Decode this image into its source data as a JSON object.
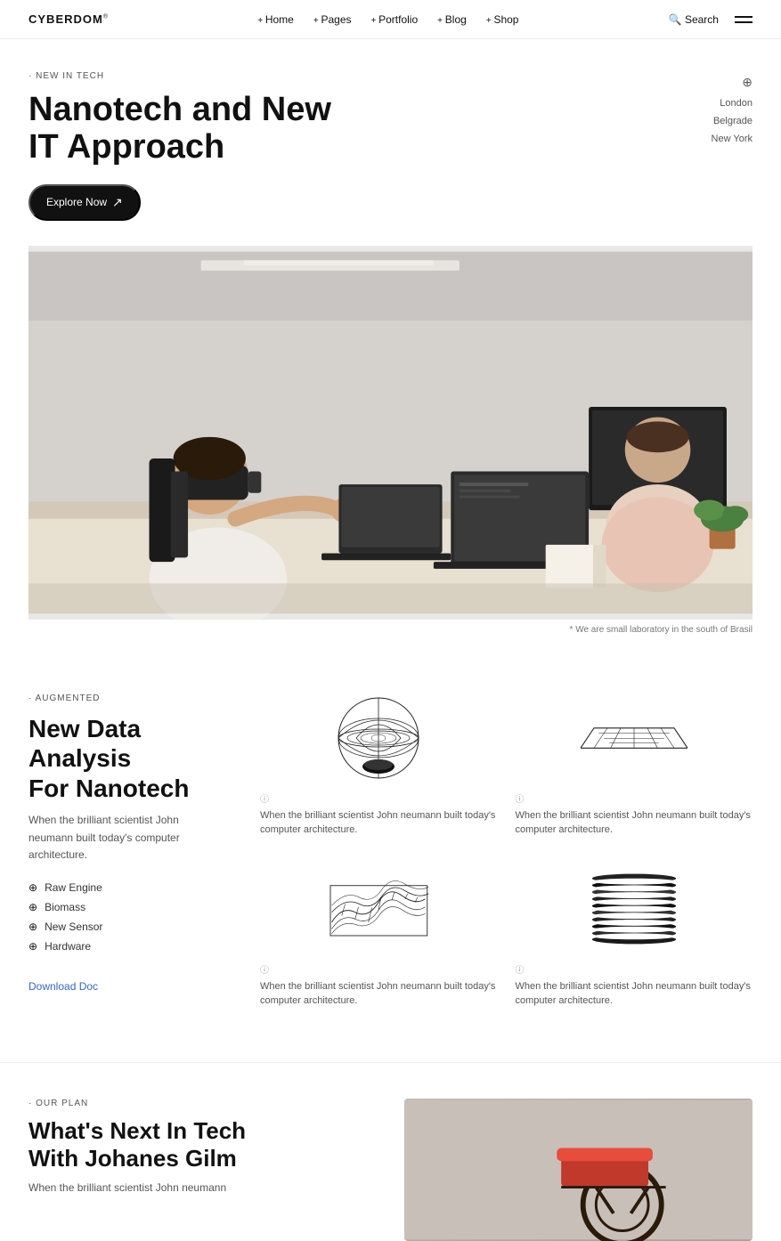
{
  "nav": {
    "logo": "CYBERDOM",
    "logo_sup": "®",
    "links": [
      {
        "label": "Home"
      },
      {
        "label": "Pages"
      },
      {
        "label": "Portfolio"
      },
      {
        "label": "Blog"
      },
      {
        "label": "Shop"
      }
    ],
    "search_label": "Search",
    "menu_label": "menu"
  },
  "hero": {
    "tag": "NEW IN TECH",
    "title_line1": "Nanotech and New",
    "title_line2": "IT Approach",
    "cta_label": "Explore Now",
    "locations_icon": "📍",
    "locations": [
      "London",
      "Belgrade",
      "New York"
    ],
    "caption": "* We are small laboratory in the south of Brasil"
  },
  "analysis": {
    "tag": "AUGMENTED",
    "title_line1": "New Data Analysis",
    "title_line2": "For Nanotech",
    "desc": "When the brilliant scientist John neumann built today's computer architecture.",
    "features": [
      {
        "label": "Raw Engine"
      },
      {
        "label": "Biomass"
      },
      {
        "label": "New Sensor"
      },
      {
        "label": "Hardware"
      }
    ],
    "download_label": "Download Doc",
    "cards": [
      {
        "shape": "sphere",
        "desc": "When the brilliant scientist John neumann built today's computer architecture."
      },
      {
        "shape": "grid",
        "desc": "When the brilliant scientist John neumann built today's computer architecture."
      },
      {
        "shape": "wave",
        "desc": "When the brilliant scientist John neumann built today's computer architecture."
      },
      {
        "shape": "cylinder",
        "desc": "When the brilliant scientist John neumann built today's computer architecture."
      }
    ]
  },
  "next_section": {
    "tag": "OUR PLAN",
    "title_line1": "What's Next In Tech",
    "title_line2": "With Johanes Gilm",
    "desc": "When the brilliant scientist John neumann"
  }
}
